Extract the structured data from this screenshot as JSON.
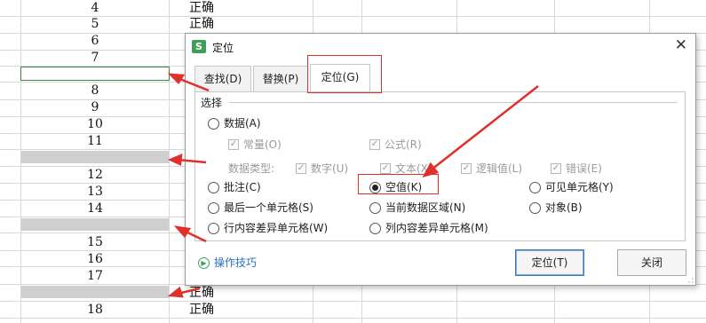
{
  "sheet": {
    "rows": [
      {
        "num": "4",
        "text": "正确"
      },
      {
        "num": "5",
        "text": "正确"
      },
      {
        "num": "6",
        "text": ""
      },
      {
        "num": "7",
        "text": ""
      },
      {
        "num": "8",
        "text": ""
      },
      {
        "num": "9",
        "text": ""
      },
      {
        "num": "10",
        "text": ""
      },
      {
        "num": "11",
        "text": ""
      },
      {
        "num": "12",
        "text": ""
      },
      {
        "num": "13",
        "text": ""
      },
      {
        "num": "14",
        "text": ""
      },
      {
        "num": "15",
        "text": ""
      },
      {
        "num": "16",
        "text": ""
      },
      {
        "num": "17",
        "text": ""
      },
      {
        "num": "",
        "text": "正确"
      },
      {
        "num": "18",
        "text": "正确"
      }
    ]
  },
  "dialog": {
    "title": "定位",
    "logo": "S",
    "close_icon": "✕",
    "tabs": [
      {
        "label": "查找(D)"
      },
      {
        "label": "替换(P)"
      },
      {
        "label": "定位(G)"
      }
    ],
    "group_label": "选择",
    "data_option": "数据(A)",
    "sub_checks": [
      {
        "label": "常量(O)"
      },
      {
        "label": "公式(R)"
      }
    ],
    "data_type_label": "数据类型:",
    "type_checks": [
      {
        "label": "数字(U)"
      },
      {
        "label": "文本(X)"
      },
      {
        "label": "逻辑值(L)"
      },
      {
        "label": "错误(E)"
      }
    ],
    "options": [
      {
        "label": "批注(C)",
        "checked": false
      },
      {
        "label": "空值(K)",
        "checked": true
      },
      {
        "label": "可见单元格(Y)",
        "checked": false
      },
      {
        "label": "最后一个单元格(S)",
        "checked": false
      },
      {
        "label": "当前数据区域(N)",
        "checked": false
      },
      {
        "label": "对象(B)",
        "checked": false
      },
      {
        "label": "行内容差异单元格(W)",
        "checked": false
      },
      {
        "label": "列内容差异单元格(M)",
        "checked": false
      }
    ],
    "tips_label": "操作技巧",
    "confirm_label": "定位(T)",
    "close_label": "关闭"
  },
  "colors": {
    "annotation": "#e0302c",
    "link": "#2a6fc0",
    "brand": "#3f9e57"
  }
}
